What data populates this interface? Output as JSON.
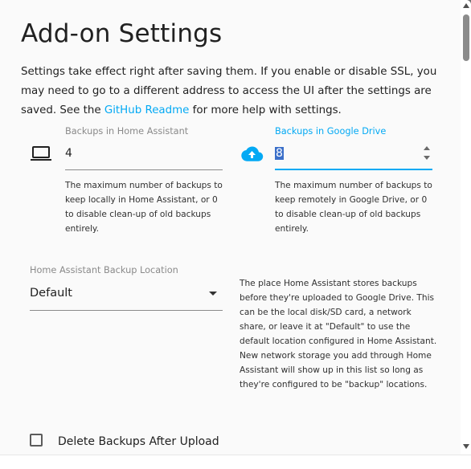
{
  "dialog": {
    "title": "Add-on Settings",
    "intro_text": "Settings take effect right after saving them. If you enable or disable SSL, you may need to go to a different address to access the UI after the settings are saved. See the ",
    "intro_link": "GitHub Readme",
    "intro_suffix": " for more help with settings."
  },
  "fields": {
    "local_backups": {
      "label": "Backups in Home Assistant",
      "value": "4",
      "icon": "laptop-icon",
      "help": "The maximum number of backups to keep locally in Home Assistant, or 0 to disable clean-up of old backups entirely."
    },
    "drive_backups": {
      "label": "Backups in Google Drive",
      "value": "8",
      "icon": "cloud-upload-icon",
      "help": "The maximum number of backups to keep remotely in Google Drive, or 0 to disable clean-up of old backups entirely."
    },
    "backup_location": {
      "label": "Home Assistant Backup Location",
      "value": "Default",
      "help": "The place Home Assistant stores backups before they're uploaded to Google Drive. This can be the local disk/SD card, a network share, or leave it at \"Default\" to use the default location configured in Home Assistant. New network storage you add through Home Assistant will show up in this list so long as they're configured to be \"backup\" locations."
    },
    "delete_after_upload": {
      "label": "Delete Backups After Upload",
      "checked": false
    }
  },
  "colors": {
    "accent": "#03a9f4",
    "text": "#212121",
    "muted": "#8a8a8a"
  }
}
